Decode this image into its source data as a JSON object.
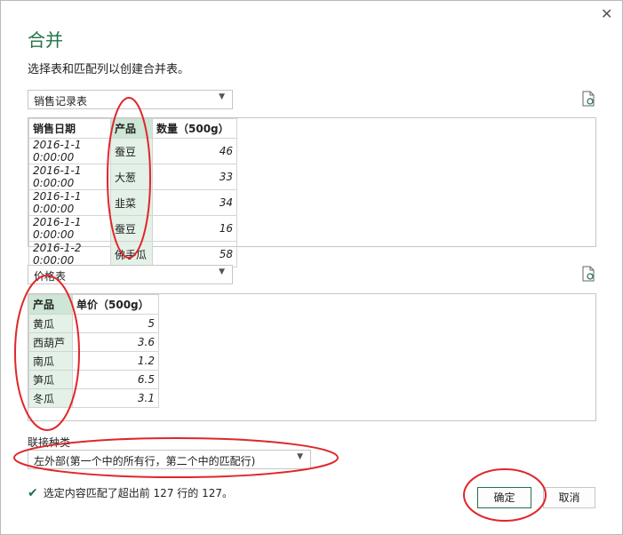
{
  "dialog": {
    "title": "合并",
    "description": "选择表和匹配列以创建合并表。",
    "close_label": "✕"
  },
  "table1": {
    "selected": "销售记录表",
    "columns": [
      "销售日期",
      "产品",
      "数量（500g）"
    ],
    "rows": [
      [
        "2016-1-1 0:00:00",
        "蚕豆",
        "46"
      ],
      [
        "2016-1-1 0:00:00",
        "大葱",
        "33"
      ],
      [
        "2016-1-1 0:00:00",
        "韭菜",
        "34"
      ],
      [
        "2016-1-1 0:00:00",
        "蚕豆",
        "16"
      ],
      [
        "2016-1-2 0:00:00",
        "佛手瓜",
        "58"
      ]
    ]
  },
  "table2": {
    "selected": "价格表",
    "columns": [
      "产品",
      "单价（500g）"
    ],
    "rows": [
      [
        "黄瓜",
        "5"
      ],
      [
        "西葫芦",
        "3.6"
      ],
      [
        "南瓜",
        "1.2"
      ],
      [
        "笋瓜",
        "6.5"
      ],
      [
        "冬瓜",
        "3.1"
      ]
    ]
  },
  "join": {
    "label": "联接种类",
    "selected": "左外部(第一个中的所有行，第二个中的匹配行)"
  },
  "status": {
    "message": "选定内容匹配了超出前 127 行的 127。"
  },
  "buttons": {
    "ok": "确定",
    "cancel": "取消"
  },
  "colors": {
    "accent": "#217346",
    "selection": "#e3f1e7",
    "annotation": "#e0262b"
  }
}
